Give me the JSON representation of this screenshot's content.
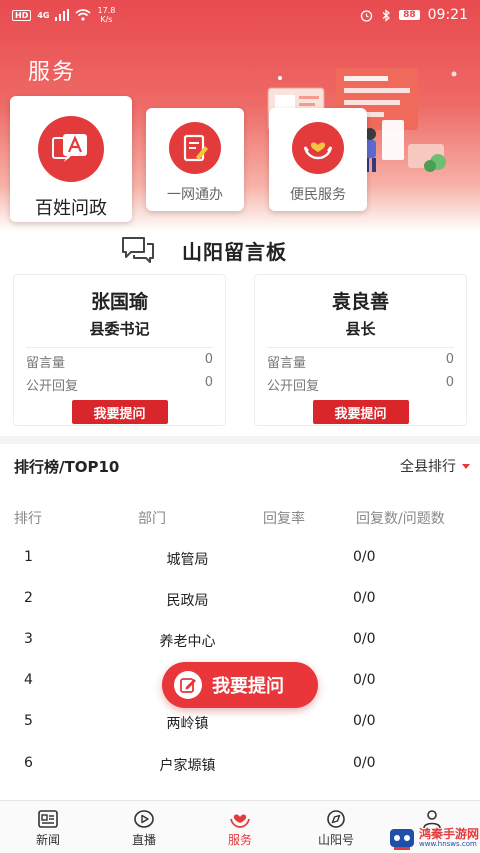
{
  "status_bar": {
    "hd": "HD",
    "network": "4G",
    "speed_value": "17.8",
    "speed_unit": "K/s",
    "battery": "88",
    "time": "09:21"
  },
  "page": {
    "title": "服务"
  },
  "services": [
    {
      "label": "百姓问政",
      "icon": "dialog-a-icon"
    },
    {
      "label": "一网通办",
      "icon": "document-pen-icon"
    },
    {
      "label": "便民服务",
      "icon": "heart-hands-icon"
    }
  ],
  "message_board": {
    "title": "山阳留言板",
    "officials": [
      {
        "name": "张国瑜",
        "role": "县委书记",
        "messages_label": "留言量",
        "messages": "0",
        "public_label": "公开回复",
        "public": "0",
        "ask_label": "我要提问"
      },
      {
        "name": "袁良善",
        "role": "县长",
        "messages_label": "留言量",
        "messages": "0",
        "public_label": "公开回复",
        "public": "0",
        "ask_label": "我要提问"
      }
    ]
  },
  "ranking": {
    "title": "排行榜/TOP10",
    "filter": "全县排行",
    "headers": {
      "rank": "排行",
      "dept": "部门",
      "rate": "回复率",
      "count": "回复数/问题数"
    },
    "rows": [
      {
        "rank": "1",
        "dept": "城管局",
        "rate": "",
        "count": "0/0"
      },
      {
        "rank": "2",
        "dept": "民政局",
        "rate": "",
        "count": "0/0"
      },
      {
        "rank": "3",
        "dept": "养老中心",
        "rate": "",
        "count": "0/0"
      },
      {
        "rank": "4",
        "dept": "",
        "rate": "",
        "count": "0/0"
      },
      {
        "rank": "5",
        "dept": "两岭镇",
        "rate": "",
        "count": "0/0"
      },
      {
        "rank": "6",
        "dept": "户家塬镇",
        "rate": "",
        "count": "0/0"
      }
    ]
  },
  "float_button": {
    "label": "我要提问"
  },
  "nav": [
    {
      "label": "新闻",
      "icon": "news-icon"
    },
    {
      "label": "直播",
      "icon": "live-play-icon"
    },
    {
      "label": "服务",
      "icon": "service-heart-icon",
      "active": true
    },
    {
      "label": "山阳号",
      "icon": "compass-icon"
    },
    {
      "label": "",
      "icon": "user-icon"
    }
  ],
  "watermark": {
    "text_line1": "鸿秦手游网",
    "text_line2": "www.hnsws.com"
  },
  "colors": {
    "accent": "#e33b3b",
    "header_top": "#e84a4f"
  }
}
